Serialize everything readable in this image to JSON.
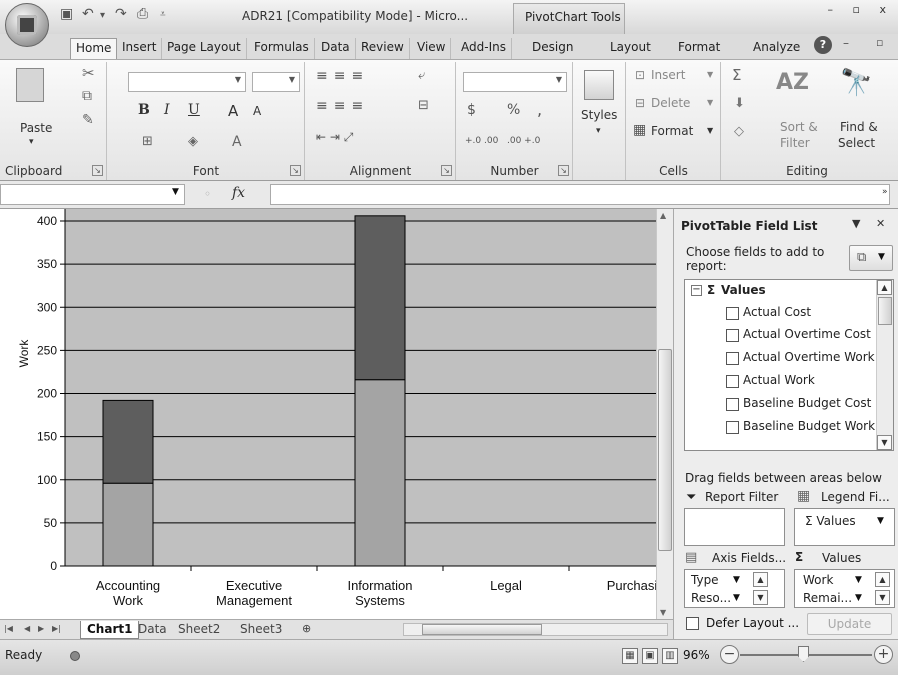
{
  "window": {
    "title": "ADR21  [Compatibility Mode] - Micro...",
    "context_tool": "PivotChart Tools",
    "controls": "– ▫ x"
  },
  "tabs": [
    "Home",
    "Insert",
    "Page Layout",
    "Formulas",
    "Data",
    "Review",
    "View",
    "Add-Ins",
    "Design",
    "Layout",
    "Format",
    "Analyze"
  ],
  "ribbon": {
    "clipboard": {
      "label": "Clipboard",
      "paste": "Paste"
    },
    "font": {
      "label": "Font",
      "bold": "B",
      "italic": "I",
      "underline": "U",
      "grow": "A",
      "shrink": "A",
      "font_color": "A"
    },
    "alignment": {
      "label": "Alignment"
    },
    "number": {
      "label": "Number",
      "currency": "$",
      "percent": "%",
      "comma": ",",
      "inc_dec": "+.0 .00",
      "dec_dec": ".00 +.0"
    },
    "styles": {
      "label": "Styles"
    },
    "cells": {
      "label": "Cells",
      "insert": "Insert",
      "delete": "Delete",
      "format": "Format"
    },
    "editing": {
      "label": "Editing",
      "sigma": "Σ",
      "sort": "Sort &",
      "filter": "Filter",
      "find": "Find &",
      "select": "Select"
    }
  },
  "formula_bar": {
    "fx": "fx",
    "value": ""
  },
  "colors": {
    "plot_bg": "#c0c0c0",
    "bar_bottom": "#a4a4a4",
    "bar_top": "#5e5e5e",
    "gridline": "#000000"
  },
  "chart_data": {
    "type": "bar",
    "stacked": true,
    "categories": [
      "Accounting Work",
      "Executive Management",
      "Information Systems",
      "Legal",
      "Purchasi"
    ],
    "category_labels": [
      [
        "Accounting",
        "Work"
      ],
      [
        "Executive",
        "Management"
      ],
      [
        "Information",
        "Systems"
      ],
      [
        "Legal"
      ],
      [
        "Purchasi"
      ]
    ],
    "series": [
      {
        "values": [
          96,
          0,
          216,
          0,
          0
        ]
      },
      {
        "values": [
          96,
          0,
          190,
          0,
          0
        ]
      }
    ],
    "ylabel": "Work",
    "ylim": [
      0,
      400
    ],
    "yticks": [
      0,
      50,
      100,
      150,
      200,
      250,
      300,
      350,
      400
    ],
    "ytick_labels": [
      "0",
      "50",
      "100",
      "150",
      "200",
      "250",
      "300",
      "350",
      "400"
    ],
    "grid": true,
    "legend": "none"
  },
  "field_list": {
    "title": "PivotTable Field List",
    "choose_label": "Choose fields to add to report:",
    "root": "Values",
    "fields": [
      "Actual Cost",
      "Actual Overtime Cost",
      "Actual Overtime Work",
      "Actual Work",
      "Baseline Budget Cost",
      "Baseline Budget Work"
    ],
    "drag_label": "Drag fields between areas below",
    "report_filter": "Report Filter",
    "legend_fields": "Legend Fi...",
    "legend_value_chip": "Σ Values",
    "axis_fields": "Axis Fields...",
    "values_area": "Values",
    "axis_items": [
      "Type",
      "Reso..."
    ],
    "value_items": [
      "Work",
      "Remai..."
    ],
    "defer_label": "Defer Layout ...",
    "update_label": "Update"
  },
  "sheets": [
    "Chart1",
    "Data",
    "Sheet2",
    "Sheet3"
  ],
  "status": {
    "ready": "Ready",
    "zoom": "96%"
  }
}
